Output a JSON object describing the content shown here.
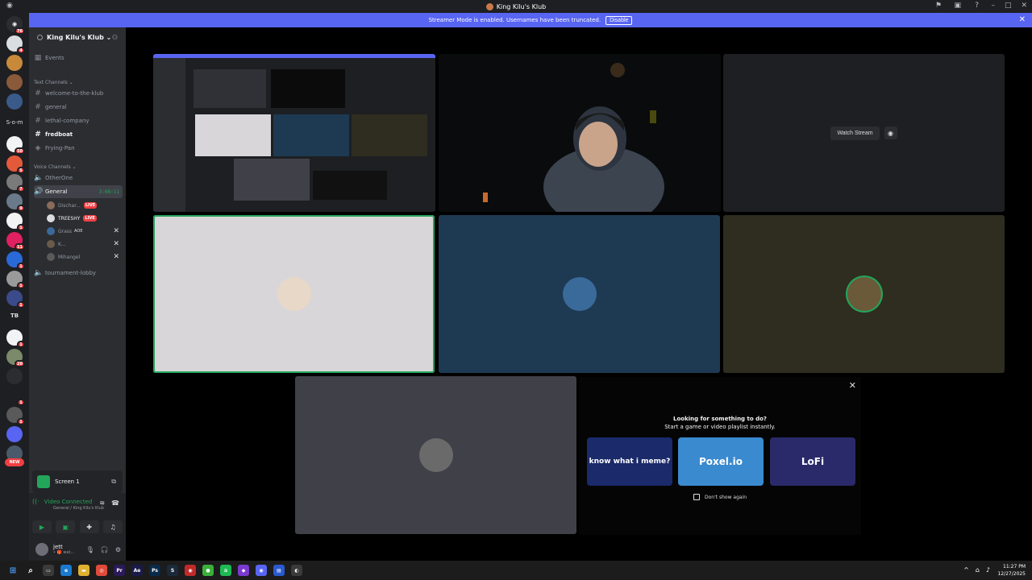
{
  "window": {
    "title": "King Kilu's Klub",
    "controls": [
      "–",
      "□",
      "✕"
    ]
  },
  "banner": {
    "text": "Streamer Mode is enabled. Usernames have been truncated.",
    "disable_label": "Disable",
    "close": "✕"
  },
  "rail": {
    "home_badge": "76",
    "som_label": "S-o-m",
    "tb_label": "TB",
    "new_label": "NEW",
    "servers": [
      {
        "color": "#dbdee1",
        "badge": "4"
      },
      {
        "color": "#c88a3a",
        "badge": ""
      },
      {
        "color": "#8a5a3a",
        "badge": ""
      },
      {
        "color": "#3a5a8a",
        "badge": ""
      },
      {
        "color": "#f2f3f5",
        "badge": "50"
      },
      {
        "color": "#e35a3a",
        "badge": "5"
      },
      {
        "color": "#7a7a7a",
        "badge": "7"
      },
      {
        "color": "#6a7a8a",
        "badge": "9"
      },
      {
        "color": "#f2f3f5",
        "badge": "1"
      },
      {
        "color": "#e02060",
        "badge": "11"
      },
      {
        "color": "#2a6ad8",
        "badge": "1"
      },
      {
        "color": "#9a9a9a",
        "badge": "1"
      },
      {
        "color": "#3a4a8a",
        "badge": "1"
      },
      {
        "color": "#f2f3f5",
        "badge": "1"
      },
      {
        "color": "#7a8a6a",
        "badge": "20"
      },
      {
        "color": "#2b2d31",
        "badge": ""
      },
      {
        "color": "#1e1f22",
        "badge": "1"
      },
      {
        "color": "#5a5a5a",
        "badge": "1"
      },
      {
        "color": "#5865f2",
        "badge": ""
      },
      {
        "color": "#4a5a6a",
        "badge": ""
      }
    ]
  },
  "sidebar": {
    "guild_name": "King Kilu's Klub ⌄",
    "events": "Events",
    "text_category": "Text Channels ⌄",
    "text_channels": [
      "welcome-to-the-klub",
      "general",
      "lethal-company",
      "fredboat",
      "Frying-Pan"
    ],
    "voice_category": "Voice Channels ⌄",
    "voice_channels": {
      "first": "OtherOne",
      "active": "General",
      "timer": "3:08:11",
      "last": "tournament-lobby"
    },
    "voice_users": [
      {
        "name": "Dischar...",
        "live": "LIVE",
        "color": "#8a6a5a"
      },
      {
        "name": "TREESHY",
        "live": "LIVE",
        "color": "#dbdee1"
      },
      {
        "name": "Grass",
        "tag": "AOE",
        "color": "#3a6a9a"
      },
      {
        "name": "K...",
        "color": "#6a5a4a"
      },
      {
        "name": "Mihangel",
        "color": "#5a5a5a"
      }
    ]
  },
  "screen_panel": {
    "label": "Screen 1"
  },
  "voice_panel": {
    "status": "Video Connected",
    "sub": "General / King Kilu's Klub"
  },
  "user": {
    "name": "jett",
    "status": "• 🎁 wat..."
  },
  "stage": {
    "watch_label": "Watch Stream",
    "tiles": [
      {
        "name": "tile-user-1",
        "bg": "#d9d6d9",
        "avatar_color": "#e8d8c8"
      },
      {
        "name": "tile-grass",
        "bg": "#1d3a52",
        "avatar_color": "#3a6a9a"
      },
      {
        "name": "tile-user-3",
        "bg": "#2e2d20",
        "avatar_color": "#6a5a3a"
      },
      {
        "name": "tile-mihangel",
        "bg": "#404049",
        "avatar_color": "#6a6a6a"
      }
    ]
  },
  "suggest": {
    "title": "Looking for something to do?",
    "subtitle": "Start a game or video playlist instantly.",
    "activities": [
      "know what i meme?",
      "Poxel.io",
      "LoFi"
    ],
    "dont_show": "Don't show again"
  },
  "taskbar": {
    "time": "11:27 PM",
    "date": "12/27/2025"
  }
}
